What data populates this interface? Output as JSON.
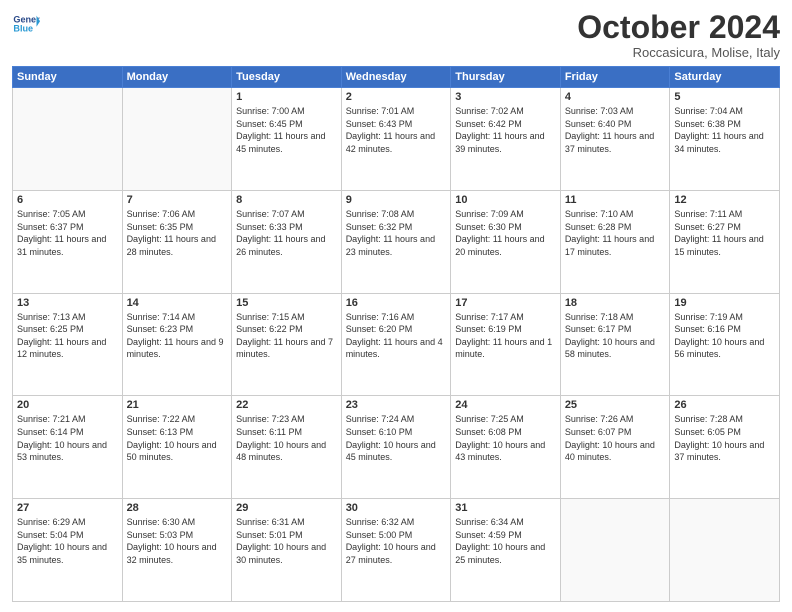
{
  "header": {
    "logo_line1": "General",
    "logo_line2": "Blue",
    "month": "October 2024",
    "location": "Roccasicura, Molise, Italy"
  },
  "weekdays": [
    "Sunday",
    "Monday",
    "Tuesday",
    "Wednesday",
    "Thursday",
    "Friday",
    "Saturday"
  ],
  "weeks": [
    [
      {
        "day": "",
        "info": ""
      },
      {
        "day": "",
        "info": ""
      },
      {
        "day": "1",
        "info": "Sunrise: 7:00 AM\nSunset: 6:45 PM\nDaylight: 11 hours and 45 minutes."
      },
      {
        "day": "2",
        "info": "Sunrise: 7:01 AM\nSunset: 6:43 PM\nDaylight: 11 hours and 42 minutes."
      },
      {
        "day": "3",
        "info": "Sunrise: 7:02 AM\nSunset: 6:42 PM\nDaylight: 11 hours and 39 minutes."
      },
      {
        "day": "4",
        "info": "Sunrise: 7:03 AM\nSunset: 6:40 PM\nDaylight: 11 hours and 37 minutes."
      },
      {
        "day": "5",
        "info": "Sunrise: 7:04 AM\nSunset: 6:38 PM\nDaylight: 11 hours and 34 minutes."
      }
    ],
    [
      {
        "day": "6",
        "info": "Sunrise: 7:05 AM\nSunset: 6:37 PM\nDaylight: 11 hours and 31 minutes."
      },
      {
        "day": "7",
        "info": "Sunrise: 7:06 AM\nSunset: 6:35 PM\nDaylight: 11 hours and 28 minutes."
      },
      {
        "day": "8",
        "info": "Sunrise: 7:07 AM\nSunset: 6:33 PM\nDaylight: 11 hours and 26 minutes."
      },
      {
        "day": "9",
        "info": "Sunrise: 7:08 AM\nSunset: 6:32 PM\nDaylight: 11 hours and 23 minutes."
      },
      {
        "day": "10",
        "info": "Sunrise: 7:09 AM\nSunset: 6:30 PM\nDaylight: 11 hours and 20 minutes."
      },
      {
        "day": "11",
        "info": "Sunrise: 7:10 AM\nSunset: 6:28 PM\nDaylight: 11 hours and 17 minutes."
      },
      {
        "day": "12",
        "info": "Sunrise: 7:11 AM\nSunset: 6:27 PM\nDaylight: 11 hours and 15 minutes."
      }
    ],
    [
      {
        "day": "13",
        "info": "Sunrise: 7:13 AM\nSunset: 6:25 PM\nDaylight: 11 hours and 12 minutes."
      },
      {
        "day": "14",
        "info": "Sunrise: 7:14 AM\nSunset: 6:23 PM\nDaylight: 11 hours and 9 minutes."
      },
      {
        "day": "15",
        "info": "Sunrise: 7:15 AM\nSunset: 6:22 PM\nDaylight: 11 hours and 7 minutes."
      },
      {
        "day": "16",
        "info": "Sunrise: 7:16 AM\nSunset: 6:20 PM\nDaylight: 11 hours and 4 minutes."
      },
      {
        "day": "17",
        "info": "Sunrise: 7:17 AM\nSunset: 6:19 PM\nDaylight: 11 hours and 1 minute."
      },
      {
        "day": "18",
        "info": "Sunrise: 7:18 AM\nSunset: 6:17 PM\nDaylight: 10 hours and 58 minutes."
      },
      {
        "day": "19",
        "info": "Sunrise: 7:19 AM\nSunset: 6:16 PM\nDaylight: 10 hours and 56 minutes."
      }
    ],
    [
      {
        "day": "20",
        "info": "Sunrise: 7:21 AM\nSunset: 6:14 PM\nDaylight: 10 hours and 53 minutes."
      },
      {
        "day": "21",
        "info": "Sunrise: 7:22 AM\nSunset: 6:13 PM\nDaylight: 10 hours and 50 minutes."
      },
      {
        "day": "22",
        "info": "Sunrise: 7:23 AM\nSunset: 6:11 PM\nDaylight: 10 hours and 48 minutes."
      },
      {
        "day": "23",
        "info": "Sunrise: 7:24 AM\nSunset: 6:10 PM\nDaylight: 10 hours and 45 minutes."
      },
      {
        "day": "24",
        "info": "Sunrise: 7:25 AM\nSunset: 6:08 PM\nDaylight: 10 hours and 43 minutes."
      },
      {
        "day": "25",
        "info": "Sunrise: 7:26 AM\nSunset: 6:07 PM\nDaylight: 10 hours and 40 minutes."
      },
      {
        "day": "26",
        "info": "Sunrise: 7:28 AM\nSunset: 6:05 PM\nDaylight: 10 hours and 37 minutes."
      }
    ],
    [
      {
        "day": "27",
        "info": "Sunrise: 6:29 AM\nSunset: 5:04 PM\nDaylight: 10 hours and 35 minutes."
      },
      {
        "day": "28",
        "info": "Sunrise: 6:30 AM\nSunset: 5:03 PM\nDaylight: 10 hours and 32 minutes."
      },
      {
        "day": "29",
        "info": "Sunrise: 6:31 AM\nSunset: 5:01 PM\nDaylight: 10 hours and 30 minutes."
      },
      {
        "day": "30",
        "info": "Sunrise: 6:32 AM\nSunset: 5:00 PM\nDaylight: 10 hours and 27 minutes."
      },
      {
        "day": "31",
        "info": "Sunrise: 6:34 AM\nSunset: 4:59 PM\nDaylight: 10 hours and 25 minutes."
      },
      {
        "day": "",
        "info": ""
      },
      {
        "day": "",
        "info": ""
      }
    ]
  ]
}
